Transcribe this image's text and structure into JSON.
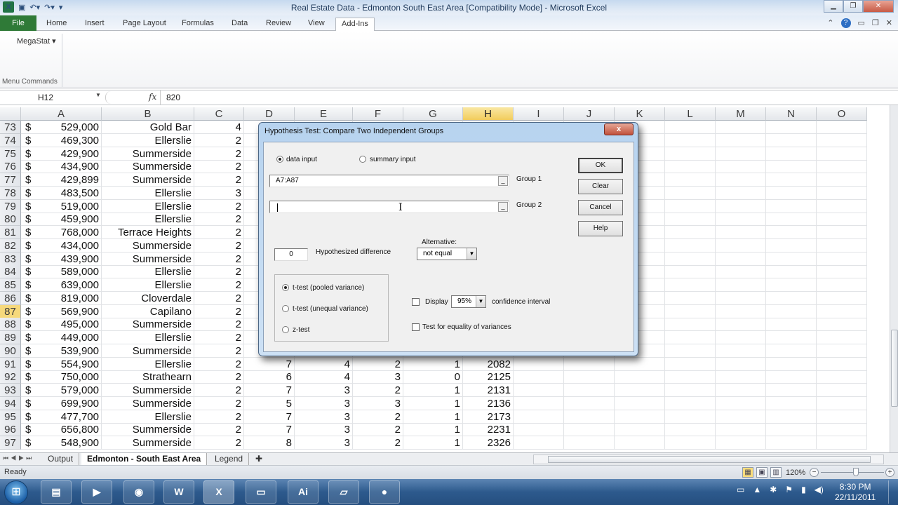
{
  "window": {
    "title": "Real Estate Data - Edmonton South East Area  [Compatibility Mode]  -  Microsoft Excel",
    "app_icon": "X"
  },
  "quick_access": {
    "save_icon": "save-icon",
    "undo_icon": "undo-icon",
    "redo_icon": "redo-icon",
    "customize_icon": "customize-icon"
  },
  "ribbon": {
    "tabs": [
      {
        "label": "File"
      },
      {
        "label": "Home"
      },
      {
        "label": "Insert"
      },
      {
        "label": "Page Layout"
      },
      {
        "label": "Formulas"
      },
      {
        "label": "Data"
      },
      {
        "label": "Review"
      },
      {
        "label": "View"
      },
      {
        "label": "Add-Ins",
        "active": true
      }
    ],
    "megastat_label": "MegaStat ▾",
    "group_label": "Menu Commands"
  },
  "formula_bar": {
    "name_box": "H12",
    "fx": "fx",
    "value": "820"
  },
  "columns": [
    "A",
    "B",
    "C",
    "D",
    "E",
    "F",
    "G",
    "H",
    "I",
    "J",
    "K",
    "L",
    "M",
    "N",
    "O"
  ],
  "selected_column": "H",
  "selected_row": "87",
  "rows": [
    {
      "n": "73",
      "cur": "$",
      "a": "529,000",
      "b": "Gold Bar",
      "c": "4"
    },
    {
      "n": "74",
      "cur": "$",
      "a": "469,300",
      "b": "Ellerslie",
      "c": "2"
    },
    {
      "n": "75",
      "cur": "$",
      "a": "429,900",
      "b": "Summerside",
      "c": "2"
    },
    {
      "n": "76",
      "cur": "$",
      "a": "434,900",
      "b": "Summerside",
      "c": "2"
    },
    {
      "n": "77",
      "cur": "$",
      "a": "429,899",
      "b": "Summerside",
      "c": "2"
    },
    {
      "n": "78",
      "cur": "$",
      "a": "483,500",
      "b": "Ellerslie",
      "c": "3"
    },
    {
      "n": "79",
      "cur": "$",
      "a": "519,000",
      "b": "Ellerslie",
      "c": "2"
    },
    {
      "n": "80",
      "cur": "$",
      "a": "459,900",
      "b": "Ellerslie",
      "c": "2"
    },
    {
      "n": "81",
      "cur": "$",
      "a": "768,000",
      "b": "Terrace Heights",
      "c": "2"
    },
    {
      "n": "82",
      "cur": "$",
      "a": "434,000",
      "b": "Summerside",
      "c": "2"
    },
    {
      "n": "83",
      "cur": "$",
      "a": "439,900",
      "b": "Summerside",
      "c": "2"
    },
    {
      "n": "84",
      "cur": "$",
      "a": "589,000",
      "b": "Ellerslie",
      "c": "2"
    },
    {
      "n": "85",
      "cur": "$",
      "a": "639,000",
      "b": "Ellerslie",
      "c": "2"
    },
    {
      "n": "86",
      "cur": "$",
      "a": "819,000",
      "b": "Cloverdale",
      "c": "2"
    },
    {
      "n": "87",
      "cur": "$",
      "a": "569,900",
      "b": "Capilano",
      "c": "2"
    },
    {
      "n": "88",
      "cur": "$",
      "a": "495,000",
      "b": "Summerside",
      "c": "2"
    },
    {
      "n": "89",
      "cur": "$",
      "a": "449,000",
      "b": "Ellerslie",
      "c": "2"
    },
    {
      "n": "90",
      "cur": "$",
      "a": "539,900",
      "b": "Summerside",
      "c": "2"
    },
    {
      "n": "91",
      "cur": "$",
      "a": "554,900",
      "b": "Ellerslie",
      "c": "2",
      "d": "7",
      "e": "4",
      "f": "2",
      "g": "1",
      "h": "2082"
    },
    {
      "n": "92",
      "cur": "$",
      "a": "750,000",
      "b": "Strathearn",
      "c": "2",
      "d": "6",
      "e": "4",
      "f": "3",
      "g": "0",
      "h": "2125"
    },
    {
      "n": "93",
      "cur": "$",
      "a": "579,000",
      "b": "Summerside",
      "c": "2",
      "d": "7",
      "e": "3",
      "f": "2",
      "g": "1",
      "h": "2131"
    },
    {
      "n": "94",
      "cur": "$",
      "a": "699,900",
      "b": "Summerside",
      "c": "2",
      "d": "5",
      "e": "3",
      "f": "3",
      "g": "1",
      "h": "2136"
    },
    {
      "n": "95",
      "cur": "$",
      "a": "477,700",
      "b": "Ellerslie",
      "c": "2",
      "d": "7",
      "e": "3",
      "f": "2",
      "g": "1",
      "h": "2173"
    },
    {
      "n": "96",
      "cur": "$",
      "a": "656,800",
      "b": "Summerside",
      "c": "2",
      "d": "7",
      "e": "3",
      "f": "2",
      "g": "1",
      "h": "2231"
    },
    {
      "n": "97",
      "cur": "$",
      "a": "548,900",
      "b": "Summerside",
      "c": "2",
      "d": "8",
      "e": "3",
      "f": "2",
      "g": "1",
      "h": "2326"
    }
  ],
  "sheets": {
    "tabs": [
      {
        "label": "Output"
      },
      {
        "label": "Edmonton - South East Area",
        "active": true
      },
      {
        "label": "Legend"
      }
    ],
    "new_sheet_icon": "insert-sheet-icon"
  },
  "status": {
    "ready": "Ready",
    "zoom": "120%",
    "zoom_minus": "−",
    "zoom_plus": "+",
    "zoom_fraction": 0.55
  },
  "dialog": {
    "title": "Hypothesis Test: Compare Two Independent Groups",
    "close": "x",
    "input_mode": {
      "data_input": "data input",
      "summary_input": "summary input",
      "selected": "data input"
    },
    "group1": {
      "value": "A7:A87",
      "label": "Group 1"
    },
    "group2": {
      "value": "",
      "label": "Group 2"
    },
    "hypothesized_difference": {
      "value": "0",
      "label": "Hypothesized difference"
    },
    "alternative": {
      "label": "Alternative:",
      "value": "not equal"
    },
    "tests": [
      {
        "label": "t-test (pooled variance)",
        "selected": true
      },
      {
        "label": "t-test (unequal variance)",
        "selected": false
      },
      {
        "label": "z-test",
        "selected": false
      }
    ],
    "display_ci": {
      "label": "Display",
      "level": "95%",
      "suffix": "confidence interval",
      "checked": false
    },
    "equality_variances": {
      "label": "Test for equality of  variances",
      "checked": false
    },
    "buttons": {
      "ok": "OK",
      "clear": "Clear",
      "cancel": "Cancel",
      "help": "Help"
    },
    "ref_button": "_"
  },
  "taskbar": {
    "start": "⊞",
    "apps": [
      {
        "name": "explorer",
        "glyph": "▤"
      },
      {
        "name": "media-player",
        "glyph": "▶"
      },
      {
        "name": "chrome",
        "glyph": "◉"
      },
      {
        "name": "word",
        "glyph": "W"
      },
      {
        "name": "excel",
        "glyph": "X",
        "active": true
      },
      {
        "name": "picture-viewer",
        "glyph": "▭"
      },
      {
        "name": "illustrator",
        "glyph": "Ai"
      },
      {
        "name": "notes",
        "glyph": "▱"
      },
      {
        "name": "camera-recorder",
        "glyph": "●"
      }
    ],
    "tray": [
      "▭",
      "▲",
      "✱",
      "⚑",
      "▮",
      "◀)"
    ],
    "time": "8:30 PM",
    "date": "22/11/2011"
  }
}
